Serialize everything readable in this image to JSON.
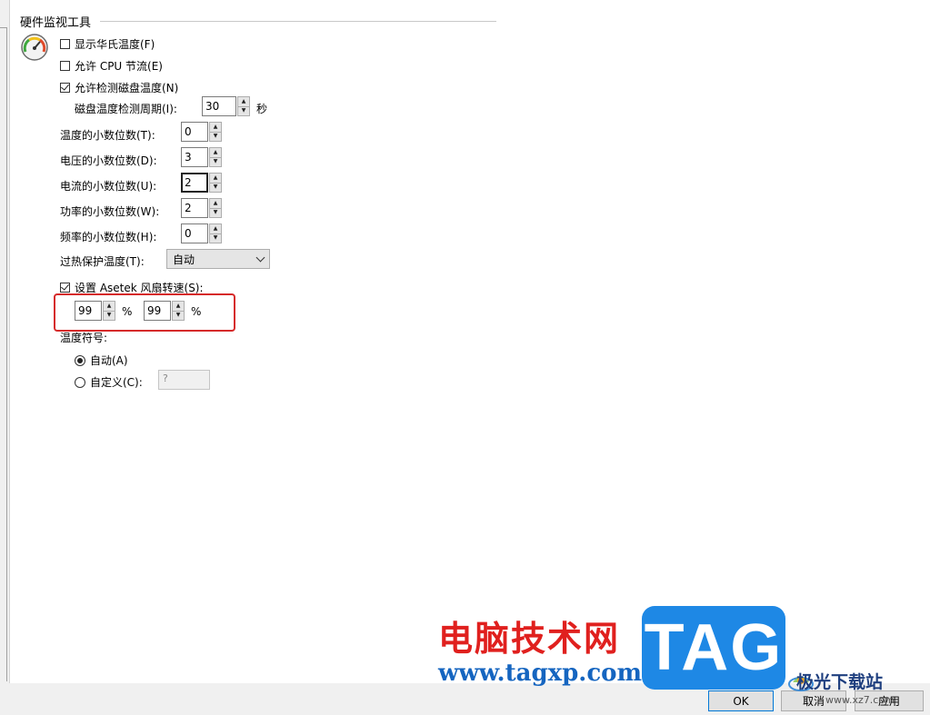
{
  "group": {
    "title": "硬件监视工具"
  },
  "options": {
    "show_fahrenheit": {
      "label": "显示华氏温度(F)",
      "checked": false
    },
    "cpu_throttle": {
      "label": "允许 CPU 节流(E)",
      "checked": false
    },
    "disk_temp": {
      "label": "允许检测磁盘温度(N)",
      "checked": true
    }
  },
  "disk_period": {
    "label": "磁盘温度检测周期(I):",
    "value": "30",
    "unit": "秒"
  },
  "decimals": [
    {
      "label": "温度的小数位数(T):",
      "value": "0"
    },
    {
      "label": "电压的小数位数(D):",
      "value": "3"
    },
    {
      "label": "电流的小数位数(U):",
      "value": "2"
    },
    {
      "label": "功率的小数位数(W):",
      "value": "2"
    },
    {
      "label": "频率的小数位数(H):",
      "value": "0"
    }
  ],
  "overheat": {
    "label": "过热保护温度(T):",
    "selected": "自动"
  },
  "asetek": {
    "label": "设置 Asetek 风扇转速(S):",
    "checked": true,
    "fan1": "99",
    "fan2": "99",
    "unit": "%"
  },
  "temp_symbol": {
    "label": "温度符号:",
    "auto": {
      "label": "自动(A)",
      "selected": true
    },
    "custom": {
      "label": "自定义(C):",
      "selected": false,
      "placeholder": "?"
    }
  },
  "buttons": {
    "ok": "OK",
    "cancel": "取消",
    "apply": "应用"
  },
  "watermark": {
    "title": "电脑技术网",
    "url": "www.tagxp.com",
    "badge": "TAG",
    "site": "极光下载站",
    "site_url": "www.xz7.com"
  },
  "colors": {
    "highlight": "#d62a2a",
    "accent": "#0078d7"
  }
}
